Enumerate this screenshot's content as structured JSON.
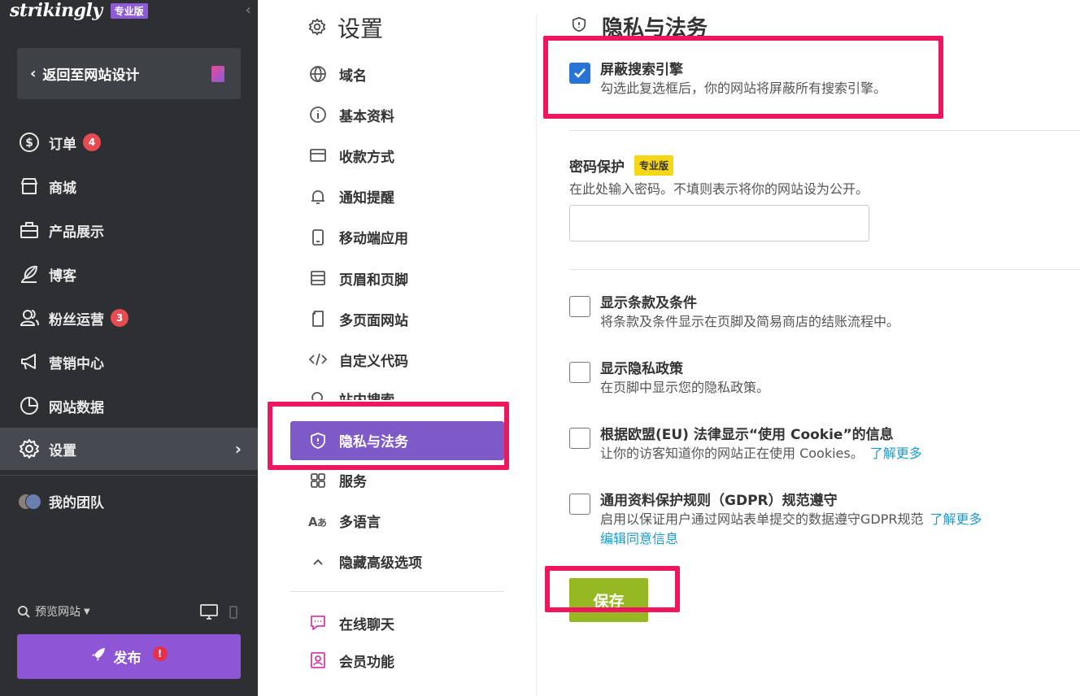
{
  "brand": {
    "logo": "strikingly",
    "plan": "专业版"
  },
  "sidebar": {
    "back_label": "返回至网站设计",
    "items": [
      {
        "label": "订单",
        "badge": "4"
      },
      {
        "label": "商城"
      },
      {
        "label": "产品展示"
      },
      {
        "label": "博客"
      },
      {
        "label": "粉丝运营",
        "badge": "3"
      },
      {
        "label": "营销中心"
      },
      {
        "label": "网站数据"
      },
      {
        "label": "设置"
      }
    ],
    "team_label": "我的团队",
    "preview_label": "预览网站",
    "publish_label": "发布",
    "publish_alert": "!"
  },
  "settings_menu": {
    "title": "设置",
    "items": [
      {
        "label": "域名"
      },
      {
        "label": "基本资料"
      },
      {
        "label": "收款方式"
      },
      {
        "label": "通知提醒"
      },
      {
        "label": "移动端应用"
      },
      {
        "label": "页眉和页脚"
      },
      {
        "label": "多页面网站"
      },
      {
        "label": "自定义代码"
      },
      {
        "label": "站内搜索"
      },
      {
        "label": "隐私与法务"
      },
      {
        "label": "服务"
      },
      {
        "label": "多语言"
      },
      {
        "label": "隐藏高级选项"
      }
    ],
    "extras": [
      {
        "label": "在线聊天"
      },
      {
        "label": "会员功能"
      }
    ]
  },
  "main": {
    "title": "隐私与法务",
    "block_search": {
      "title": "屏蔽搜索引擎",
      "desc": "勾选此复选框后，你的网站将屏蔽所有搜索引擎。",
      "checked": true
    },
    "password": {
      "label": "密码保护",
      "badge": "专业版",
      "desc": "在此处输入密码。不填则表示将你的网站设为公开。",
      "value": ""
    },
    "terms": {
      "title": "显示条款及条件",
      "desc": "将条款及条件显示在页脚及简易商店的结账流程中。"
    },
    "privacy": {
      "title": "显示隐私政策",
      "desc": "在页脚中显示您的隐私政策。"
    },
    "cookie": {
      "title": "根据欧盟(EU) 法律显示“使用 Cookie”的信息",
      "desc": "让你的访客知道你的网站正在使用 Cookies。",
      "link": "了解更多"
    },
    "gdpr": {
      "title": "通用资料保护规则（GDPR）规范遵守",
      "desc": "启用以保证用户通过网站表单提交的数据遵守GDPR规范",
      "link": "了解更多",
      "link2": "编辑同意信息"
    },
    "save_label": "保存"
  },
  "colors": {
    "accent": "#7e59c8",
    "highlight": "#f0165d",
    "save": "#96b822",
    "checkbox": "#2774d4"
  }
}
